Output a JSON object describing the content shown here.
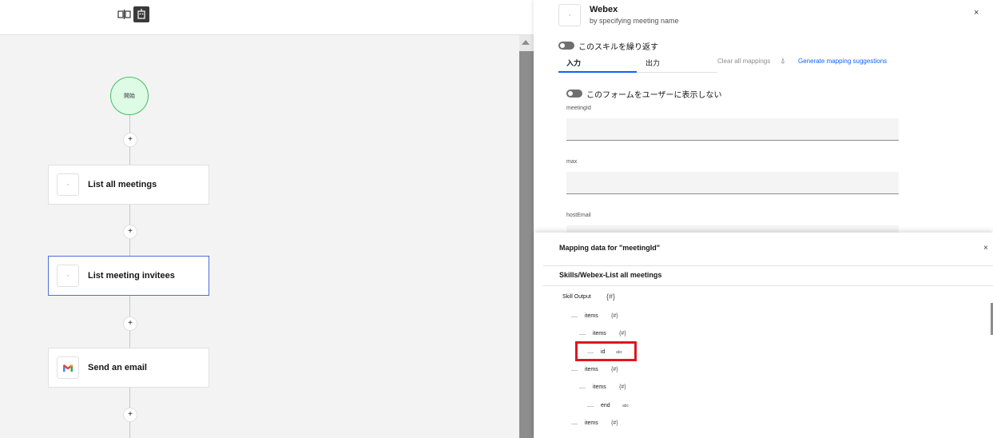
{
  "toolbar": {
    "icons": [
      "split-view-icon",
      "robot-icon"
    ]
  },
  "flow": {
    "start_label": "開始",
    "add_label": "+",
    "nodes": [
      {
        "label": "List all meetings",
        "icon": "app-icon"
      },
      {
        "label": "List meeting invitees",
        "icon": "app-icon",
        "selected": true
      },
      {
        "label": "Send an email",
        "icon": "gmail-icon"
      }
    ]
  },
  "panel": {
    "title": "Webex",
    "subtitle": "by specifying meeting name",
    "close": "×",
    "repeat_toggle": "このスキルを繰り返す",
    "tabs": [
      "入力",
      "出力"
    ],
    "clear_mappings": "Clear all mappings",
    "generate_suggestions": "Generate mapping suggestions",
    "hide_form_toggle": "このフォームをユーザーに表示しない",
    "fields": [
      {
        "label": "meetingId",
        "value": ""
      },
      {
        "label": "max",
        "value": ""
      },
      {
        "label": "hostEmail",
        "value": ""
      }
    ]
  },
  "mapping": {
    "title": "Mapping data for \"meetingId\"",
    "close": "×",
    "source": "Skills/Webex-List all meetings",
    "root_label": "Skill Output",
    "root_type": "{#}",
    "tree": [
      {
        "label": "items",
        "type": "{#}"
      },
      {
        "label": "items",
        "type": "{#}"
      },
      {
        "label": "id",
        "type": "abc",
        "highlighted": true
      },
      {
        "label": "items",
        "type": "{#}"
      },
      {
        "label": "items",
        "type": "{#}"
      },
      {
        "label": "end",
        "type": "abc"
      },
      {
        "label": "items",
        "type": "{#}"
      }
    ]
  },
  "colors": {
    "accent": "#0f62fe",
    "highlight": "#e0161f",
    "start_fill": "#defbe6",
    "start_border": "#42be65"
  }
}
